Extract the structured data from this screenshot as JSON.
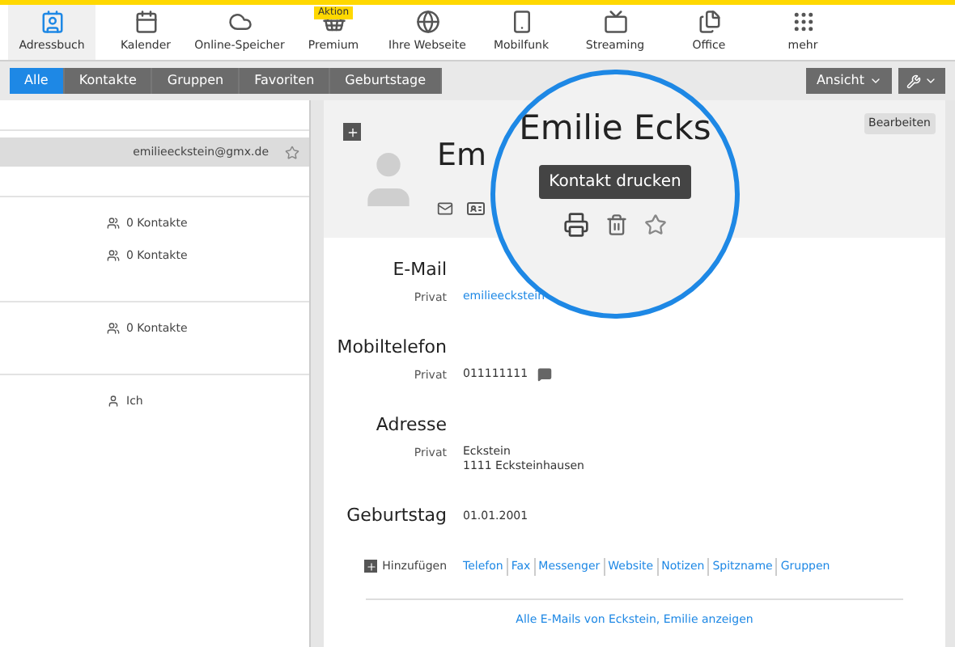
{
  "nav": [
    {
      "label": "Adressbuch",
      "kind": "contacts",
      "selected": true
    },
    {
      "label": "Kalender",
      "kind": "calendar",
      "selected": false
    },
    {
      "label": "Online-Speicher",
      "kind": "cloud",
      "selected": false
    },
    {
      "label": "Premium",
      "kind": "basket",
      "selected": false,
      "badge": "Aktion"
    },
    {
      "label": "Ihre Webseite",
      "kind": "globe",
      "selected": false
    },
    {
      "label": "Mobilfunk",
      "kind": "sim",
      "selected": false
    },
    {
      "label": "Streaming",
      "kind": "tv",
      "selected": false
    },
    {
      "label": "Office",
      "kind": "files",
      "selected": false
    },
    {
      "label": "mehr",
      "kind": "grid",
      "selected": false
    }
  ],
  "filters": [
    {
      "label": "Alle",
      "selected": true
    },
    {
      "label": "Kontakte",
      "selected": false
    },
    {
      "label": "Gruppen",
      "selected": false
    },
    {
      "label": "Favoriten",
      "selected": false
    },
    {
      "label": "Geburtstage",
      "selected": false
    }
  ],
  "view_button": "Ansicht",
  "list": [
    {
      "kind": "contact",
      "text": "emilieeckstein@gmx.de",
      "selected": true
    },
    {
      "kind": "divider"
    },
    {
      "kind": "group",
      "text": "0 Kontakte"
    },
    {
      "kind": "group",
      "text": "0 Kontakte"
    },
    {
      "kind": "divider"
    },
    {
      "kind": "group",
      "text": "0 Kontakte"
    },
    {
      "kind": "divider"
    },
    {
      "kind": "me",
      "text": "Ich"
    }
  ],
  "contact": {
    "name": "Em",
    "edit_button": "Bearbeiten",
    "magnifier": {
      "name": "Emilie Ecks",
      "tooltip": "Kontakt drucken"
    },
    "fields": [
      {
        "label": "E-Mail",
        "type": "Privat",
        "lines": [
          "emilieeckstein"
        ],
        "kind": "link"
      },
      {
        "label": "Mobiltelefon",
        "type": "Privat",
        "lines": [
          "011111111"
        ],
        "kind": "phone"
      },
      {
        "label": "Adresse",
        "type": "Privat",
        "lines": [
          "Eckstein",
          "1111 Ecksteinhausen"
        ],
        "kind": "text"
      },
      {
        "label": "Geburtstag",
        "lines": [
          "01.01.2001"
        ]
      }
    ],
    "add_label": "Hinzufügen",
    "add_links": [
      "Telefon",
      "Fax",
      "Messenger",
      "Website",
      "Notizen",
      "Spitzname",
      "Gruppen"
    ],
    "footer_link": "Alle E-Mails von Eckstein, Emilie anzeigen"
  }
}
